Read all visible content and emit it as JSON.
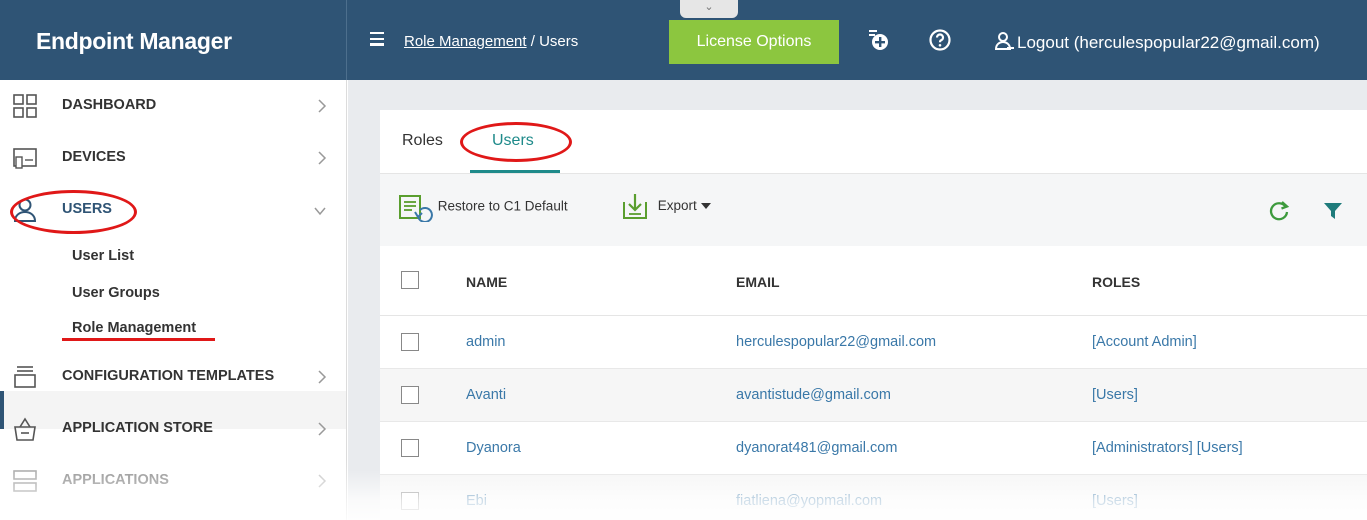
{
  "brand": {
    "title": "Endpoint Manager"
  },
  "header": {
    "breadcrumb_link": "Role Management",
    "breadcrumb_sep": " / ",
    "breadcrumb_current": "Users",
    "license_button": "License Options",
    "logout": "Logout (herculespopular22@gmail.com)",
    "pulltab": "⌄"
  },
  "sidebar": {
    "items": [
      {
        "label": "DASHBOARD",
        "icon": "dashboard-icon"
      },
      {
        "label": "DEVICES",
        "icon": "devices-icon"
      },
      {
        "label": "USERS",
        "icon": "user-icon",
        "expanded": true
      },
      {
        "label": "CONFIGURATION TEMPLATES",
        "icon": "templates-icon"
      },
      {
        "label": "APPLICATION STORE",
        "icon": "store-icon"
      },
      {
        "label": "APPLICATIONS",
        "icon": "applications-icon"
      }
    ],
    "subitems": [
      {
        "label": "User List"
      },
      {
        "label": "User Groups"
      },
      {
        "label": "Role Management",
        "active": true
      }
    ]
  },
  "tabs": [
    {
      "label": "Roles",
      "active": false
    },
    {
      "label": "Users",
      "active": true
    }
  ],
  "toolbar": {
    "restore": "Restore to C1 Default",
    "export": "Export"
  },
  "table": {
    "columns": [
      "NAME",
      "EMAIL",
      "ROLES"
    ],
    "rows": [
      {
        "name": "admin",
        "email": "herculespopular22@gmail.com",
        "roles": "[Account Admin]"
      },
      {
        "name": "Avanti",
        "email": "avantistude@gmail.com",
        "roles": "[Users]"
      },
      {
        "name": "Dyanora",
        "email": "dyanorat481@gmail.com",
        "roles": "[Administrators] [Users]"
      },
      {
        "name": "Ebi",
        "email": "fiatliena@yopmail.com",
        "roles": "[Users]"
      }
    ]
  },
  "colors": {
    "header_bg": "#2f5475",
    "accent_green": "#8cc63f",
    "link_blue": "#3a78a8",
    "tab_teal": "#1e8a8a",
    "annotation_red": "#e01818"
  }
}
